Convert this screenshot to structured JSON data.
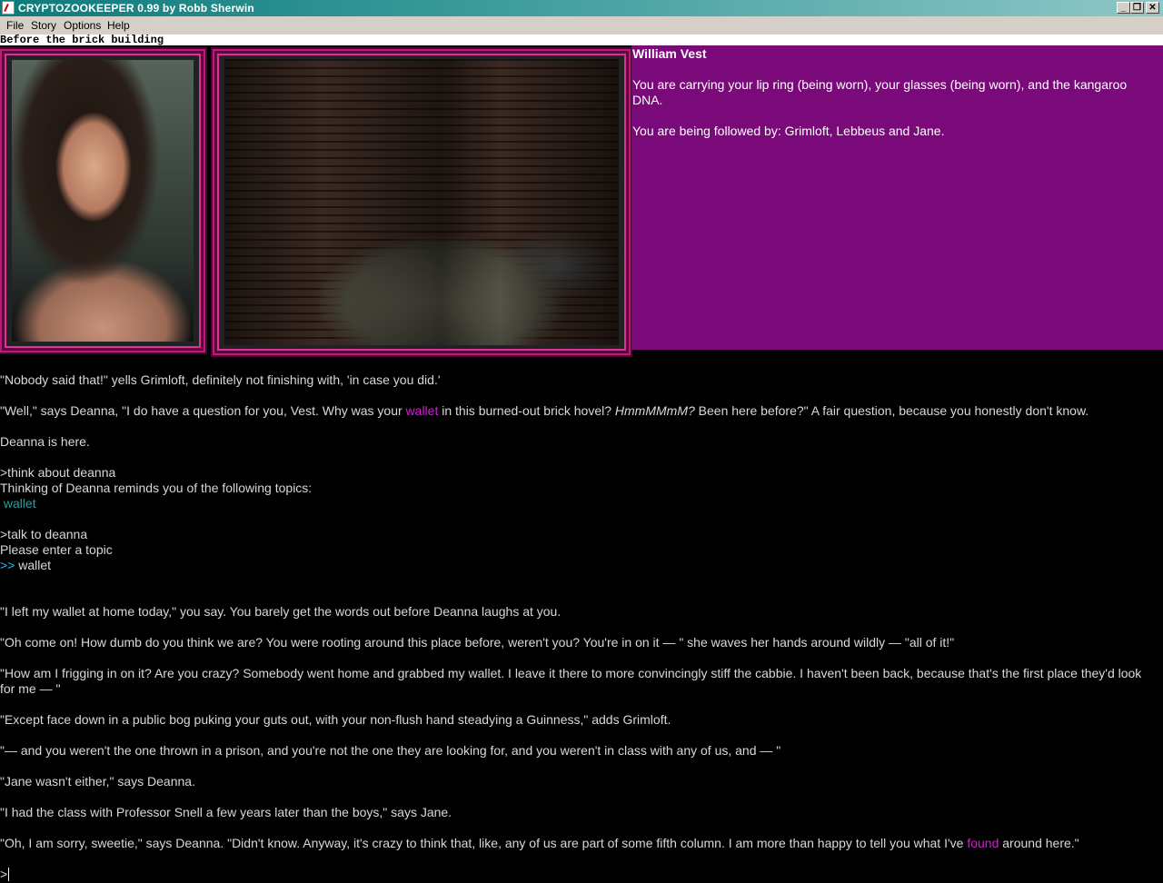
{
  "window": {
    "title": "CRYPTOZOOKEEPER 0.99 by Robb Sherwin",
    "buttons": {
      "minimize": "_",
      "restore": "❐",
      "close": "✕"
    }
  },
  "menu": [
    "File",
    "Story",
    "Options",
    "Help"
  ],
  "status": "Before the brick building",
  "side": {
    "name": "William Vest",
    "inventory": "You are carrying your lip ring (being worn), your glasses (being worn), and the kangaroo DNA.",
    "followers": "You are being followed by: Grimloft, Lebbeus and Jane."
  },
  "transcript": {
    "l1": "\"Nobody said that!\" yells Grimloft, definitely not finishing with, 'in case you did.'",
    "l2a": "\"Well,\" says Deanna, \"I do have a question for you, Vest. Why was your ",
    "l2b": "wallet",
    "l2c": " in this burned-out brick hovel? ",
    "l2d": "HmmMMmM?",
    "l2e": " Been here before?\" A fair question, because you honestly don't know.",
    "l3": "Deanna is here.",
    "l4": ">think about deanna",
    "l5": "Thinking of Deanna reminds you of the following topics:",
    "l6": " wallet",
    "l7": ">talk to deanna",
    "l8": "Please enter a topic",
    "l9a": ">>",
    "l9b": " wallet",
    "l10": "\"I left my wallet at home today,\" you say. You barely get the words out before Deanna laughs at you.",
    "l11": "\"Oh come on! How dumb do you think we are? You were rooting around this place before, weren't you? You're in on it — \" she waves her hands around wildly — \"all of it!\"",
    "l12": "\"How am I frigging in on it? Are you crazy? Somebody went home and grabbed my wallet. I leave it there to more convincingly stiff the cabbie. I haven't been back, because that's the first place they'd look for me — \"",
    "l13": "\"Except face down in a public bog puking your guts out, with your non-flush hand steadying a Guinness,\" adds Grimloft.",
    "l14": "\"— and you weren't the one thrown in a prison, and you're not the one they are looking for, and you weren't in class with any of us, and — \"",
    "l15": "\"Jane wasn't either,\" says Deanna.",
    "l16": "\"I had the class with Professor Snell a few years later than the boys,\" says Jane.",
    "l17a": "\"Oh, I am sorry, sweetie,\" says Deanna. \"Didn't know. Anyway, it's crazy to think that, like, any of us are part of some fifth column. I am more than happy to tell you what I've ",
    "l17b": "found",
    "l17c": " around here.\"",
    "prompt": ">"
  },
  "colors": {
    "panel": "#7a0a7a",
    "frame": "#c2187a",
    "highlight": "#d020d0",
    "topic": "#2aa0a0"
  }
}
